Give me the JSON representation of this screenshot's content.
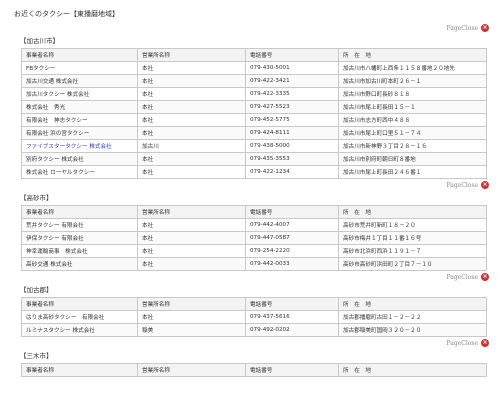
{
  "page_heading": "お近くのタクシー【東播磨地域】",
  "pageclose_label": "PageClose",
  "headers": [
    "事業者名称",
    "営業所名称",
    "電話番号",
    "所　在　地"
  ],
  "sections": [
    {
      "title": "【加古川市】",
      "rows": [
        {
          "name": "FBタクシー",
          "office": "本社",
          "phone": "079-430-5001",
          "address": "加古川市八幡町上西条１１５８番地２０地先"
        },
        {
          "name": "加古川交通 株式会社",
          "office": "本社",
          "phone": "079-422-3421",
          "address": "加古川市加古川町本町２６－１"
        },
        {
          "name": "加古川タクシー 株式会社",
          "office": "本社",
          "phone": "079-422-3335",
          "address": "加古川市野口町長砂８１８"
        },
        {
          "name": "株式会社　秀光",
          "office": "本社",
          "phone": "079-427-5523",
          "address": "加古川市尾上町長田１５－１"
        },
        {
          "name": "有限会社　神志タクシー",
          "office": "本社",
          "phone": "079-452-5775",
          "address": "加古川市志方町西中４８８"
        },
        {
          "name": "有限会社 浜の宮タクシー",
          "office": "本社",
          "phone": "079-424-8111",
          "address": "加古川市尾上町口里５１－７４"
        },
        {
          "name": "ファイブスタータクシー 株式会社",
          "office": "加古川",
          "phone": "079-438-5000",
          "address": "加古川市新神野３丁目２８－１６",
          "link": true
        },
        {
          "name": "別府タクシー 株式会社",
          "office": "本社",
          "phone": "079-435-3553",
          "address": "加古川市別府町朝日町８番地"
        },
        {
          "name": "株式会社 ローヤルタクシー",
          "office": "本社",
          "phone": "079-422-1234",
          "address": "加古川市尾上町長田２４６番１"
        }
      ]
    },
    {
      "title": "【高砂市】",
      "rows": [
        {
          "name": "荒井タクシー 有限会社",
          "office": "本社",
          "phone": "079-442-4007",
          "address": "高砂市荒井町新町１８－２０"
        },
        {
          "name": "伊保タクシー 有限会社",
          "office": "本社",
          "phone": "079-447-0587",
          "address": "高砂市梅井１丁目１１番１６号"
        },
        {
          "name": "神幸運輸商事　株式会社",
          "office": "本社",
          "phone": "079-254-2220",
          "address": "高砂市北浜町西浜１１９１－７"
        },
        {
          "name": "高砂交通 株式会社",
          "office": "本社",
          "phone": "079-442-0033",
          "address": "高砂市高砂町浜田町２丁目７－１０"
        }
      ]
    },
    {
      "title": "【加古郡】",
      "rows": [
        {
          "name": "はりま高砂タクシー　有限会社",
          "office": "本社",
          "phone": "079-437-5616",
          "address": "加古郡播磨町古田１－２－２２"
        },
        {
          "name": "ルミナスタクシー 株式会社",
          "office": "稲美",
          "phone": "079-492-0202",
          "address": "加古郡稲美町国岡３２０－２０"
        }
      ]
    },
    {
      "title": "【三木市】",
      "rows": []
    }
  ]
}
